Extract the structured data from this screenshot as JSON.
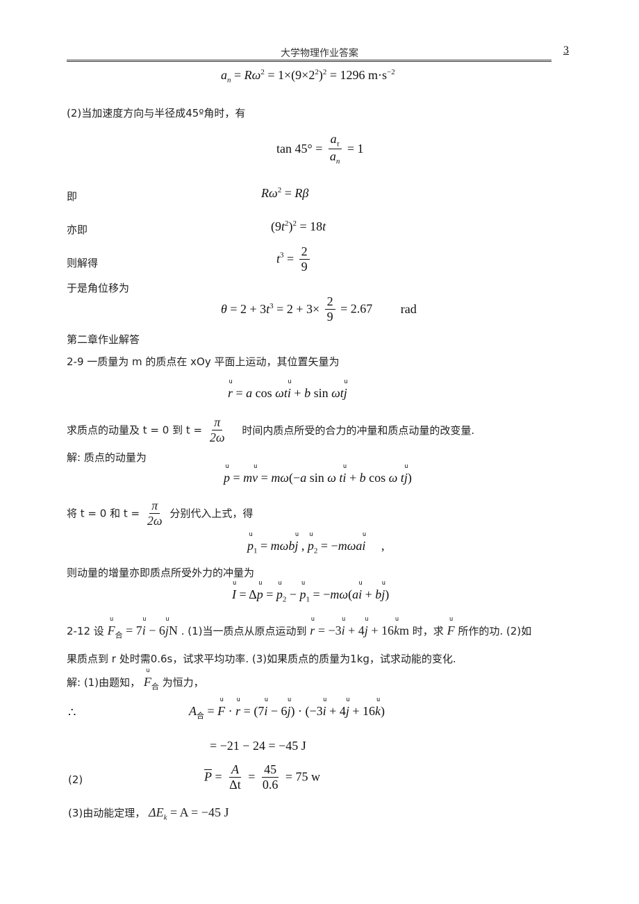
{
  "header": {
    "title": "大学物理作业答案",
    "page_number": "3"
  },
  "lines": {
    "eq_an": "",
    "p2_label": "(2)当加速度方向与半径成45º角时，有",
    "ji": "即",
    "yiji": "亦即",
    "zejiede": "则解得",
    "yushi": "于是角位移为",
    "chapter2": "第二章作业解答",
    "q29": "2-9  一质量为 m 的质点在 xOy 平面上运动，其位置矢量为",
    "q29_ask_a": "求质点的动量及 t = 0  到 t =",
    "q29_ask_b": "时间内质点所受的合力的冲量和质点动量的改变量.",
    "sol_a": "解:   质点的动量为",
    "sub_a": "将 t = 0 和 t =",
    "sub_b": "分别代入上式，得",
    "impulse": "则动量的增量亦即质点所受外力的冲量为",
    "q212_a": "2-12  设",
    "q212_b": ". (1)当一质点从原点运动到",
    "q212_c": "时，求",
    "q212_d": "所作的功. (2)如",
    "q212_line2": "果质点到 r 处时需0.6s，试求平均功率. (3)如果质点的质量为1kg，试求动能的变化.",
    "sol212_a": "解: (1)由题知，",
    "sol212_b": "为恒力，",
    "therefore": "∴",
    "p2": "(2)",
    "p3": "(3)由动能定理，"
  },
  "equations": {
    "an_lhs": "a",
    "an_rest": " = Rω² = 1×(9×2²)² = 1296 m·s⁻²",
    "tan": "tan 45° =",
    "tan_num": "a",
    "tan_den": "a",
    "tan_rhs": "= 1",
    "rw": "Rω² = Rβ",
    "nine_t": "(9t²)² = 18t",
    "t3_lhs": "t³ =",
    "t3_num": "2",
    "t3_den": "9",
    "theta_a": "θ = 2 + 3t³ = 2 + 3×",
    "theta_num": "2",
    "theta_den": "9",
    "theta_b": "= 2.67",
    "theta_unit": "rad",
    "r_vec": "= a cos ωt",
    "r_vec_b": " + b sin ωt",
    "pi": "π",
    "two_omega": "2ω",
    "p_eq": "= m",
    "p_eq_b": "= mω(−a sin ωt",
    "p_eq_c": " + b cos ωt",
    "p_eq_d": ")",
    "p1": "= mωb",
    "p2": "= −mωa",
    "impulse_eq": "= −mω(a",
    "F_val": "= 7",
    "F_val_b": " − 6",
    "F_unit": "N",
    "r212": "= −3",
    "r212_b": " + 4",
    "r212_c": " + 16",
    "r212_unit": "m",
    "A_lhs": "A",
    "A_eq": "= (7",
    "A_line2": "= −21 − 24 = −45 J",
    "P_rhs": "= 75 w",
    "P_num1": "A",
    "P_den1": "Δt",
    "P_num2": "45",
    "P_den2": "0.6",
    "Ek": "ΔE",
    "Ek_rhs": "= A = −45 J"
  }
}
